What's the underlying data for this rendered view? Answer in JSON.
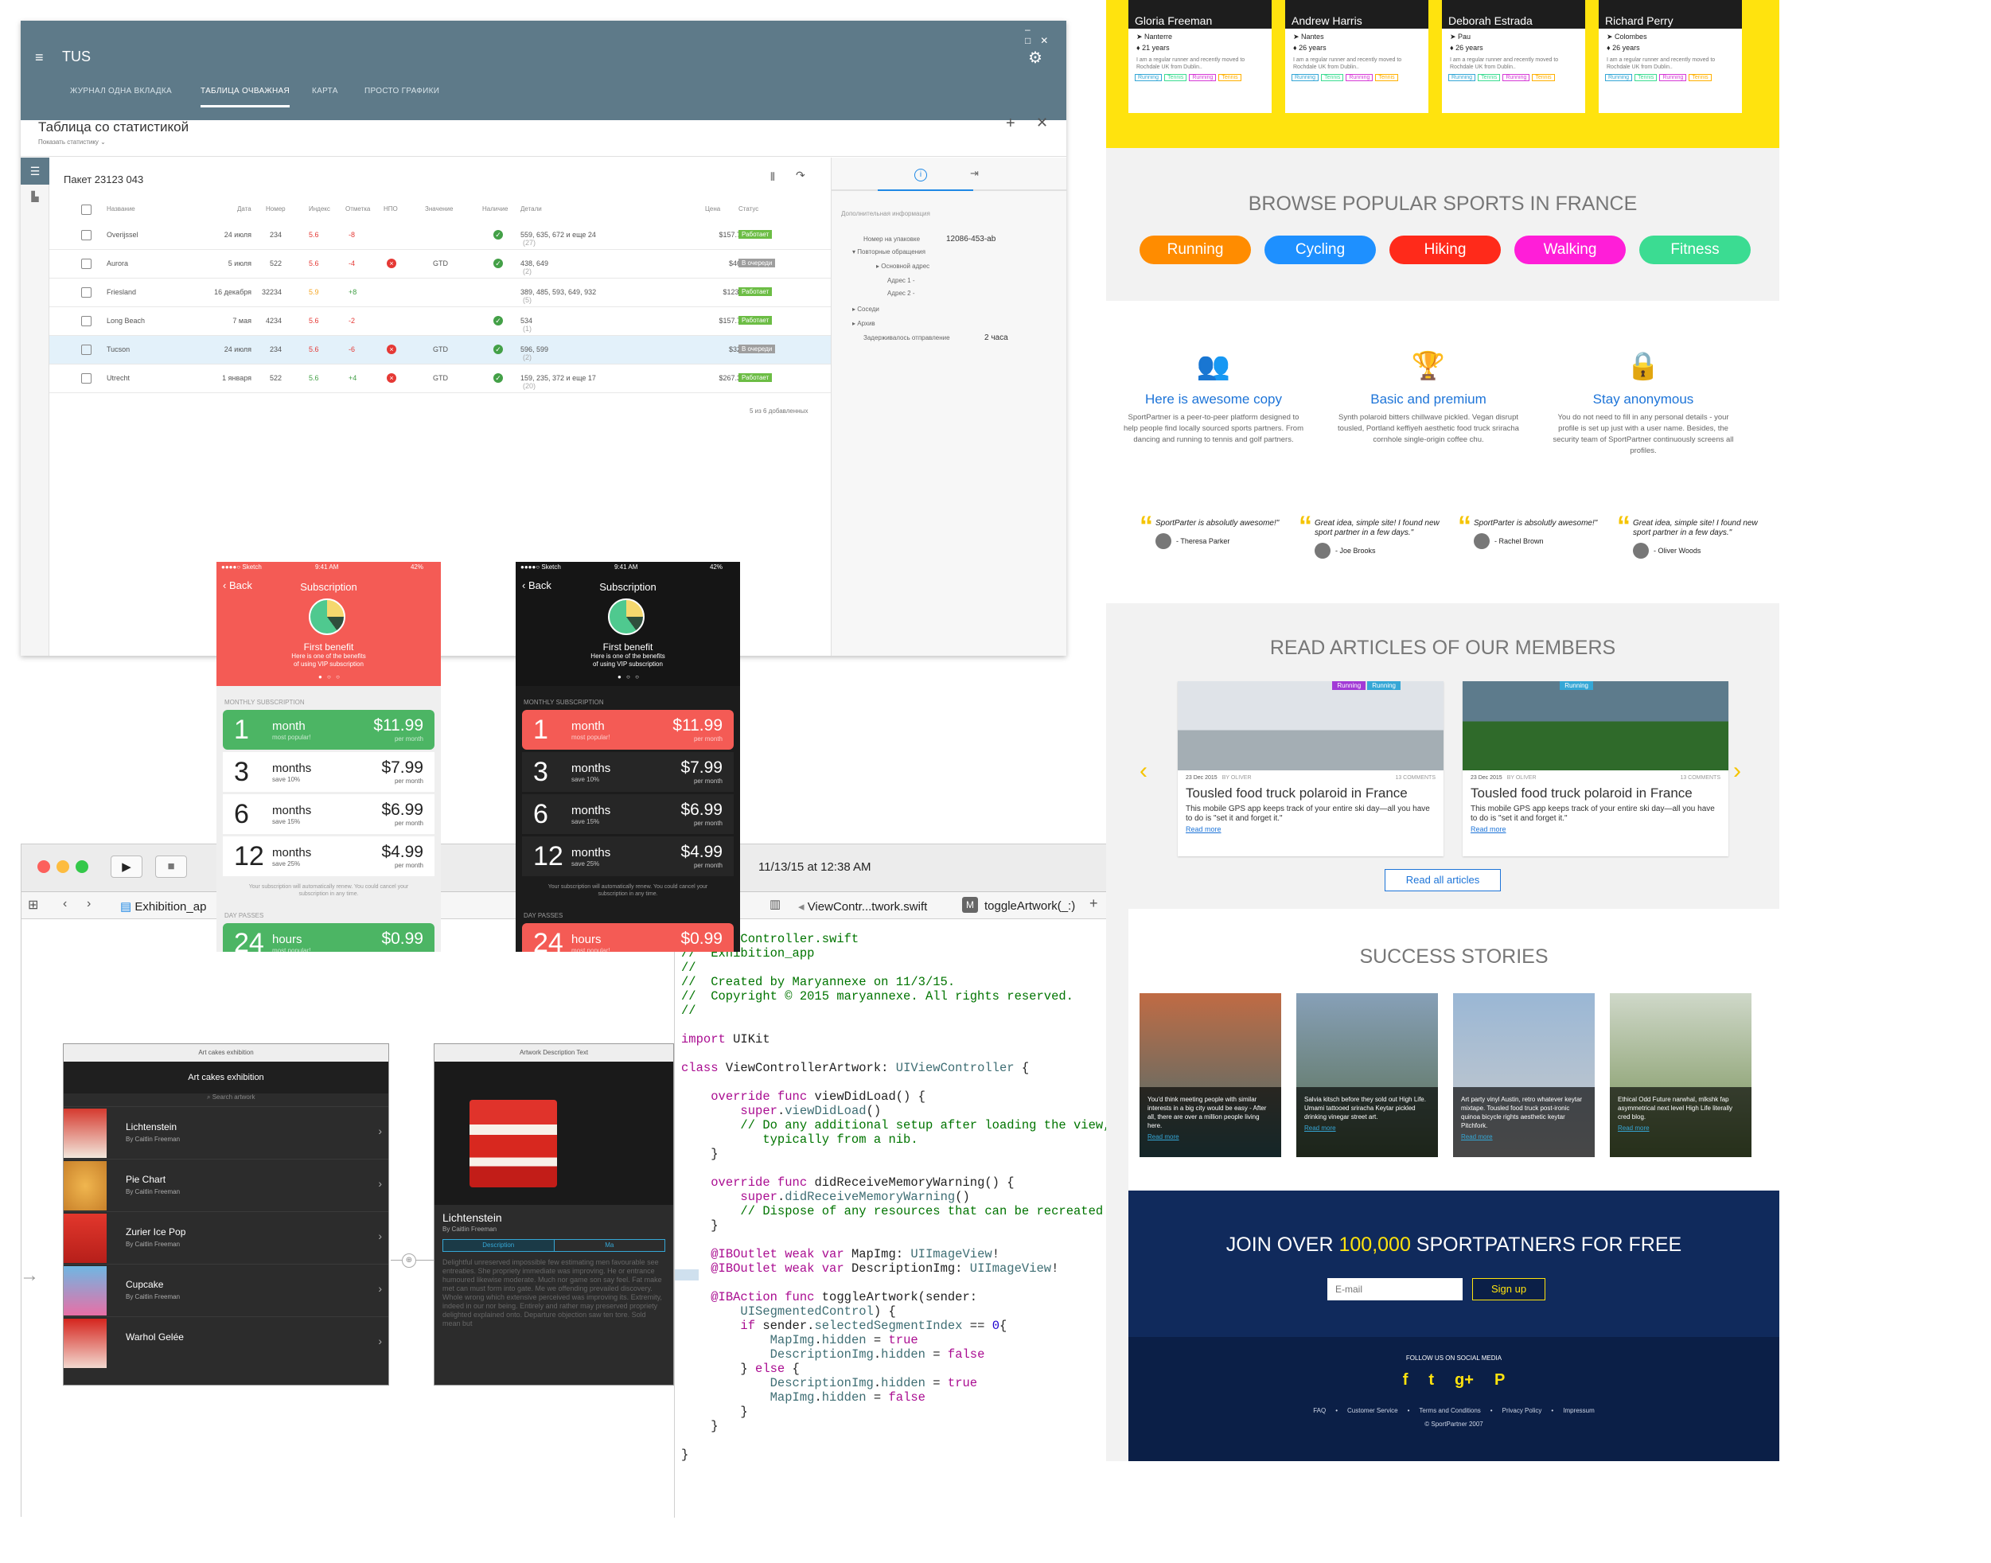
{
  "tus": {
    "app_title": "TUS",
    "window_controls": [
      "–",
      "□",
      "✕"
    ],
    "tabs": [
      "ЖУРНАЛ ОДНА ВКЛАДКА",
      "ТАБЛИЦА ОЧВАЖНАЯ",
      "КАРТА",
      "ПРОСТО ГРАФИКИ"
    ],
    "page_title": "Таблица со статистикой",
    "show_stats": "Показать статистику",
    "package": "Пакет 23123 043",
    "columns": [
      "Название",
      "Дата",
      "Номер",
      "Индекс",
      "Отметка",
      "НПО",
      "Значение",
      "Наличие",
      "Детали",
      "Цена",
      "Статус"
    ],
    "rows": [
      {
        "name": "Overijssel",
        "date": "24 июля",
        "num": "234",
        "idx": "5.6",
        "mark": "-8",
        "npo": "",
        "val": "",
        "avail": true,
        "details": "559, 635, 672 и еще 24",
        "dcount": "(27)",
        "price": "$157.73",
        "status": "Работает",
        "st": "work"
      },
      {
        "name": "Aurora",
        "date": "5 июля",
        "num": "522",
        "idx": "5.6",
        "mark": "-4",
        "npo": "x",
        "val": "GTD",
        "avail": true,
        "details": "438, 649",
        "dcount": "(2)",
        "price": "$463",
        "status": "В очереди",
        "st": "queue"
      },
      {
        "name": "Friesland",
        "date": "16 декабря",
        "num": "32234",
        "idx": "5.9",
        "mark": "+8",
        "npo": "",
        "val": "",
        "avail": false,
        "details": "389, 485, 593, 649, 932",
        "dcount": "(5)",
        "price": "$123.5",
        "status": "Работает",
        "st": "work"
      },
      {
        "name": "Long Beach",
        "date": "7 мая",
        "num": "4234",
        "idx": "5.6",
        "mark": "-2",
        "npo": "",
        "val": "",
        "avail": true,
        "details": "534",
        "dcount": "(1)",
        "price": "$157.73",
        "status": "Работает",
        "st": "work"
      },
      {
        "name": "Tucson",
        "date": "24 июля",
        "num": "234",
        "idx": "5.6",
        "mark": "-6",
        "npo": "x",
        "val": "GTD",
        "avail": true,
        "details": "596, 599",
        "dcount": "(2)",
        "price": "$329",
        "status": "В очереди",
        "st": "queue"
      },
      {
        "name": "Utrecht",
        "date": "1 января",
        "num": "522",
        "idx": "5.6",
        "mark": "+4",
        "npo": "x",
        "val": "GTD",
        "avail": true,
        "details": "159, 235, 372 и еще 17",
        "dcount": "(20)",
        "price": "$267.35",
        "status": "Работает",
        "st": "work"
      }
    ],
    "footer_count": "5 из 6 добавленных",
    "side": {
      "title": "Дополнительная информация",
      "pack_label": "Номер на упаковке",
      "pack_val": "12086-453-ab",
      "repeat": "Повторные обращения",
      "main_addr": "Основной адрес",
      "addr1": "Адрес 1",
      "addr2": "Адрес 2",
      "neighbors": "Соседи",
      "archive": "Архив",
      "delay_label": "Задерживалось отправление",
      "delay_val": "2 часа",
      "dash": "-"
    }
  },
  "phones": [
    {
      "theme": "light",
      "carrier": "●●●●○ Sketch",
      "time": "9:41 AM",
      "battery": "42%",
      "back": "Back",
      "title": "Subscription",
      "benefit": "First benefit",
      "benefit_text": "Here is one of the benefits of using VIP subscription",
      "monthly": "MONTHLY SUBSCRIPTION",
      "note": "Your subscription will automatically renew. You could cancel your subscription in any time.",
      "day": "DAY PASSES",
      "plans": [
        {
          "n": "1",
          "u": "month",
          "s": "most popular!",
          "p": "$11.99",
          "per": "per month"
        },
        {
          "n": "3",
          "u": "months",
          "s": "save 10%",
          "p": "$7.99",
          "per": "per month"
        },
        {
          "n": "6",
          "u": "months",
          "s": "save 15%",
          "p": "$6.99",
          "per": "per month"
        },
        {
          "n": "12",
          "u": "months",
          "s": "save 25%",
          "p": "$4.99",
          "per": "per month"
        }
      ],
      "pass": {
        "n": "24",
        "u": "hours",
        "s": "most popular!",
        "p": "$0.99"
      }
    },
    {
      "theme": "dark",
      "carrier": "●●●●○ Sketch",
      "time": "9:41 AM",
      "battery": "42%",
      "back": "Back",
      "title": "Subscription",
      "benefit": "First benefit",
      "benefit_text": "Here is one of the benefits of using VIP subscription",
      "monthly": "MONTHLY SUBSCRIPTION",
      "note": "Your subscription will automatically renew. You could cancel your subscription in any time.",
      "day": "DAY PASSES",
      "plans": [
        {
          "n": "1",
          "u": "month",
          "s": "most popular!",
          "p": "$11.99",
          "per": "per month"
        },
        {
          "n": "3",
          "u": "months",
          "s": "save 10%",
          "p": "$7.99",
          "per": "per month"
        },
        {
          "n": "6",
          "u": "months",
          "s": "save 15%",
          "p": "$6.99",
          "per": "per month"
        },
        {
          "n": "12",
          "u": "months",
          "s": "save 25%",
          "p": "$4.99",
          "per": "per month"
        }
      ],
      "pass": {
        "n": "24",
        "u": "hours",
        "s": "most popular!",
        "p": "$0.99"
      }
    }
  ],
  "xcode": {
    "timestamp": "11/13/15 at 12:38 AM",
    "left_tab": "Exhibition_ap",
    "right_tab": "ViewContr...twork.swift",
    "method_tab": "toggleArtwork(_:)",
    "method_icon": "M",
    "screen1_header": "Art cakes exhibition",
    "screen1_title": "Art cakes exhibition",
    "search_placeholder": "Search artwork",
    "items": [
      {
        "t": "Lichtenstein",
        "a": "By Caitlin Freeman"
      },
      {
        "t": "Pie Chart",
        "a": "By Caitlin Freeman"
      },
      {
        "t": "Zurier Ice Pop",
        "a": "By Caitlin Freeman"
      },
      {
        "t": "Cupcake",
        "a": "By Caitlin Freeman"
      },
      {
        "t": "Warhol Gelée",
        "a": ""
      }
    ],
    "screen2_header": "Artwork Description Text",
    "screen2_title": "Lichtenstein",
    "screen2_author": "By Caitlin Freeman",
    "segment": [
      "Description",
      "Ma"
    ],
    "lorem": "Delightful unreserved impossible few estimating men favourable see entreaties. She propriety immediate was improving. He or entrance humoured likewise moderate. Much nor game son say feel. Fat make met can must form into gate. Me we offending prevailed discovery. Whole wrong which extensive perceived was improving its. Extremity, indeed in our nor being. Entirely and rather may preserved propriety delighted explained onto. Departure objection saw ten tore. Sold mean but"
  },
  "sport": {
    "people": [
      {
        "name": "Gloria Freeman",
        "city": "Nanterre",
        "age": "21 years"
      },
      {
        "name": "Andrew Harris",
        "city": "Nantes",
        "age": "26 years"
      },
      {
        "name": "Deborah Estrada",
        "city": "Pau",
        "age": "26 years"
      },
      {
        "name": "Richard Perry",
        "city": "Colombes",
        "age": "26 years"
      }
    ],
    "bio": "I am a regular runner and recently moved to Rochdale UK from Dublin..",
    "tags": [
      "Running",
      "Tennis",
      "Running",
      "Tennis"
    ],
    "browse_a": "BROWSE POPULAR SPORTS IN ",
    "browse_b": "FRANCE",
    "sports": [
      {
        "label": "Running",
        "color": "#ff8c00"
      },
      {
        "label": "Cycling",
        "color": "#1e90ff"
      },
      {
        "label": "Hiking",
        "color": "#ff2a1a"
      },
      {
        "label": "Walking",
        "color": "#ff1ed8"
      },
      {
        "label": "Fitness",
        "color": "#3bdc92"
      }
    ],
    "features": [
      {
        "title": "Here is awesome copy",
        "text": "SportPartner is a peer-to-peer platform designed to help people find locally sourced sports partners. From dancing and running to tennis and golf partners."
      },
      {
        "title": "Basic and premium",
        "text": "Synth polaroid bitters chillwave pickled. Vegan disrupt tousled, Portland keffiyeh aesthetic food truck sriracha cornhole single-origin coffee chu."
      },
      {
        "title": "Stay anonymous",
        "text": "You do not need to fill in any personal details - your profile is set up just with a user name. Besides, the security team of SportPartner continuously screens all profiles."
      }
    ],
    "quotes": [
      {
        "q": "SportParter is absolutly awesome!\"",
        "a": "- Theresa Parker"
      },
      {
        "q": "Great idea, simple site! I found new sport partner in a few days.\"",
        "a": "- Joe Brooks"
      },
      {
        "q": "SportParter is absolutly awesome!\"",
        "a": "- Rachel Brown"
      },
      {
        "q": "Great idea, simple site! I found new sport partner in a few days.\"",
        "a": "- Oliver Woods"
      }
    ],
    "articles_title": "READ ARTICLES OF OUR MEMBERS",
    "articles": [
      {
        "tags": [
          "Running",
          "Running"
        ],
        "date": "23 Dec 2015",
        "by": "BY OLIVER",
        "comments": "13 COMMENTS",
        "title": "Tousled food truck polaroid in France",
        "text": "This mobile GPS app keeps track of your entire ski day—all you have to do is \"set it and forget it.\"",
        "more": "Read more"
      },
      {
        "tags": [
          "Running"
        ],
        "date": "23 Dec 2015",
        "by": "BY OLIVER",
        "comments": "13 COMMENTS",
        "title": "Tousled food truck polaroid in France",
        "text": "This mobile GPS app keeps track of your entire ski day—all you have to do is \"set it and forget it.\"",
        "more": "Read more"
      }
    ],
    "read_all": "Read all articles",
    "stories_title": "SUCCESS STORIES",
    "stories": [
      {
        "text": "You'd think meeting people with similar interests in a big city would be easy - After all, there are over a million people living here.",
        "more": "Read more"
      },
      {
        "text": "Salvia kitsch before they sold out High Life. Umami tattooed sriracha Keytar pickled drinking vinegar street art.",
        "more": "Read more"
      },
      {
        "text": "Art party vinyl Austin, retro whatever keytar mixtape. Tousled food truck post-ironic quinoa bicycle rights aesthetic keytar Pitchfork.",
        "more": "Read more"
      },
      {
        "text": "Ethical Odd Future narwhal, mlkshk fap asymmetrical next level High Life literally cred blog.",
        "more": "Read more"
      }
    ],
    "join_a": "JOIN OVER ",
    "join_b": "100,000",
    "join_c": " SPORTPATNERS ",
    "join_d": "FOR FREE",
    "email_placeholder": "E-mail",
    "signup": "Sign up",
    "follow": "FOLLOW US ON SOCIAL MEDIA",
    "social": [
      "f",
      "t",
      "g+",
      "P"
    ],
    "footer_links": [
      "FAQ",
      "Customer Service",
      "Terms and Conditions",
      "Privacy Policy",
      "Impressum"
    ],
    "copyright": "© SportPartner 2007"
  },
  "colors": {
    "tus_bar": "#5e7a89",
    "work": "#6cbd45",
    "queue": "#9e9e9e",
    "yellow": "#ffe30e",
    "navy": "#102a5c",
    "red": "#f45b55"
  }
}
